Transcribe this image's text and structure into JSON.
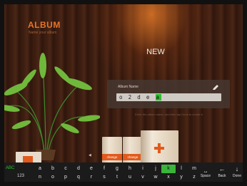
{
  "header": {
    "title": "ALBUM",
    "subtitle": "Name your album"
  },
  "page": {
    "title": "NEW"
  },
  "name_panel": {
    "label": "Album Name",
    "text_before_cursor": "o 2 d e",
    "cursor_char": "a",
    "edit_icon": "pencil-icon"
  },
  "hint": "Enter the album name, and then tap Done to create it.",
  "books": [
    {
      "label": "change"
    },
    {
      "label": "change"
    }
  ],
  "add_icon": "plus-icon",
  "keyboard": {
    "mode_label": "ABC",
    "numbers_label": "123",
    "row1": [
      "a",
      "b",
      "c",
      "d",
      "e",
      "f",
      "g",
      "h",
      "i",
      "j",
      "k",
      "l",
      "m"
    ],
    "row2": [
      "n",
      "o",
      "p",
      "q",
      "r",
      "s",
      "t",
      "u",
      "v",
      "w",
      "x",
      "y",
      "z"
    ],
    "active_key": "k",
    "space": {
      "glyph": "⎵",
      "label": "Space"
    },
    "back": {
      "glyph": "←",
      "label": "Back"
    },
    "done": {
      "glyph": "↓",
      "label": "Done"
    }
  },
  "colors": {
    "accent": "#e8742a",
    "key_active": "#3ab53a",
    "cover_band": "#e15a1c"
  }
}
